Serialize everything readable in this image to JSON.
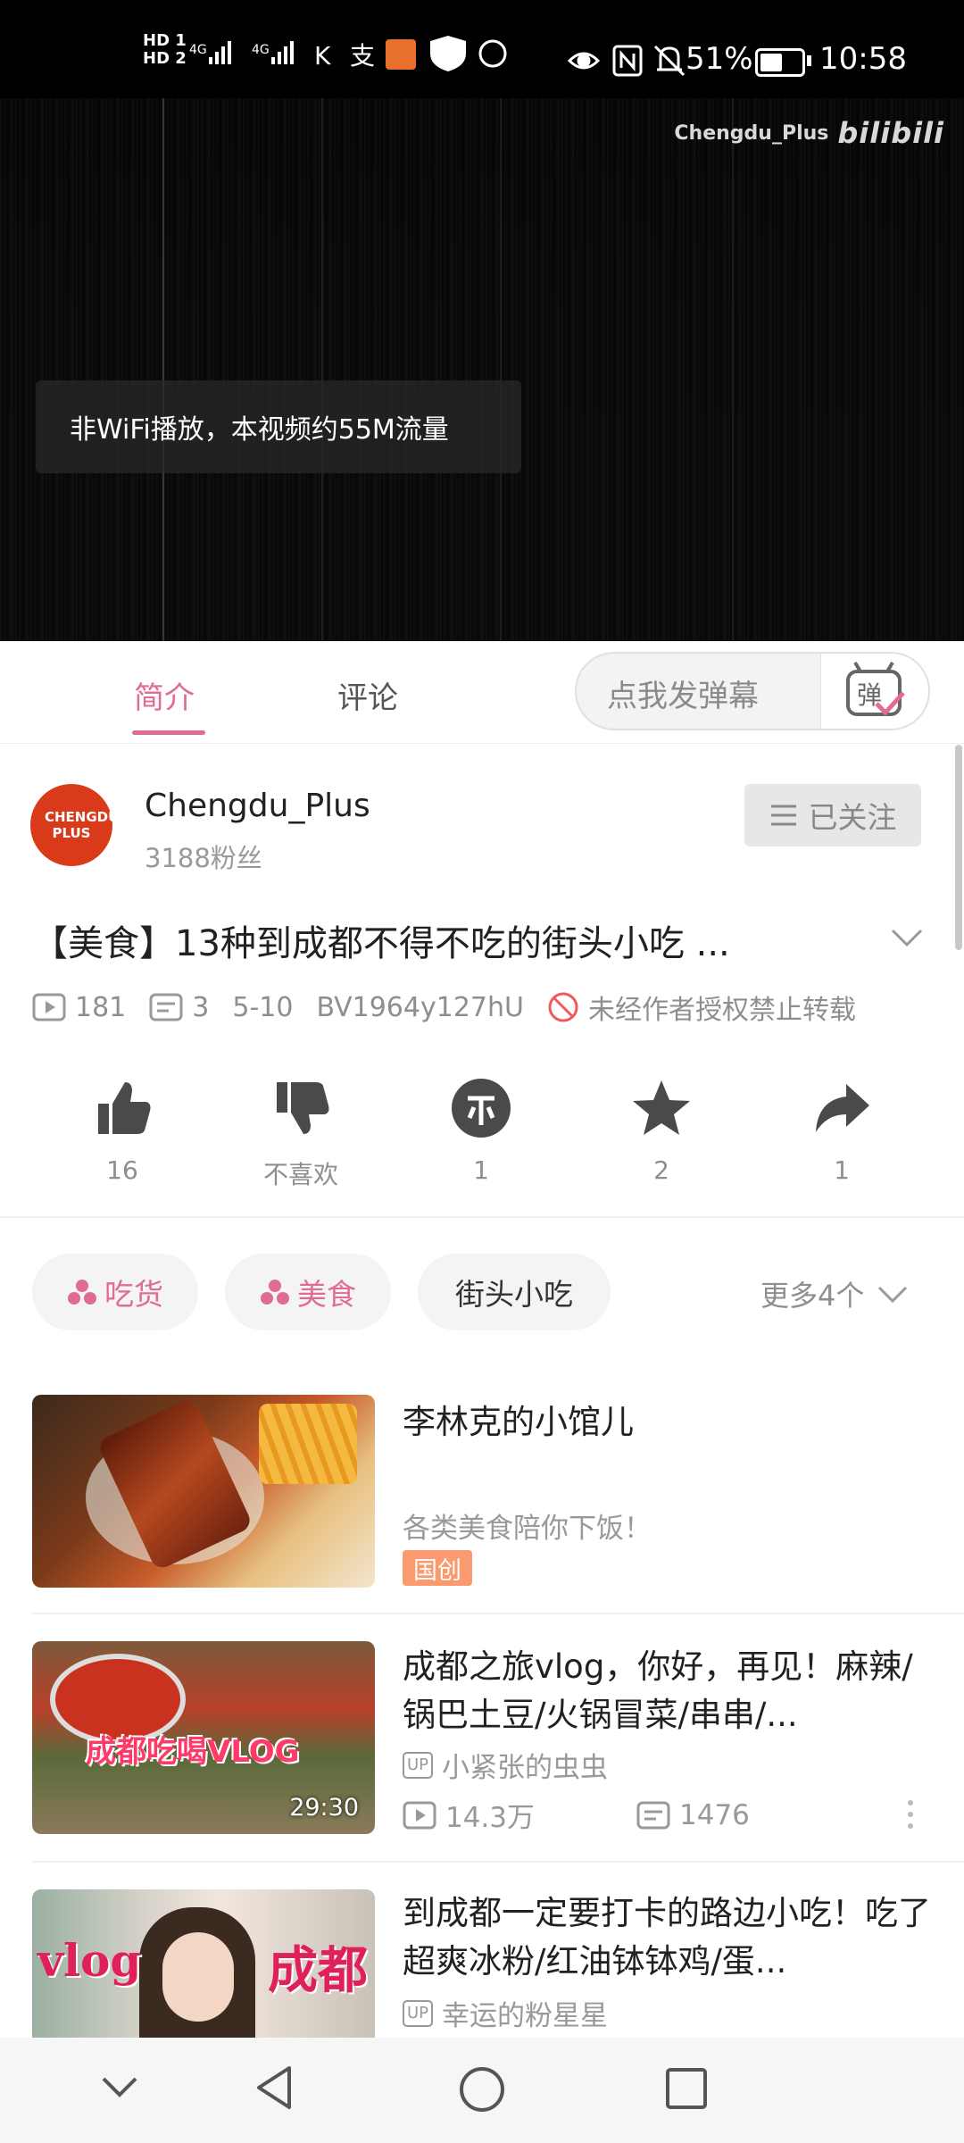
{
  "status_bar": {
    "battery": "51%",
    "time": "10:58"
  },
  "player": {
    "watermark_channel": "Chengdu_Plus",
    "watermark_logo": "bilibili",
    "toast": "非WiFi播放，本视频约55M流量"
  },
  "tabs": [
    {
      "label": "简介",
      "active": true
    },
    {
      "label": "评论",
      "active": false
    }
  ],
  "danmaku_input": {
    "placeholder": "点我发弹幕",
    "icon": "danmaku-toggle-icon"
  },
  "uploader": {
    "avatar_text": "CHENGDU PLUS",
    "name": "Chengdu_Plus",
    "fans": "3188粉丝",
    "follow_label": "已关注"
  },
  "video": {
    "title": "【美食】13种到成都不得不吃的街头小吃 ...",
    "views": "181",
    "danmaku_count": "3",
    "date": "5-10",
    "bvid": "BV1964y127hU",
    "copyright": "未经作者授权禁止转载"
  },
  "actions": [
    {
      "icon": "thumbs-up-icon",
      "label": "16"
    },
    {
      "icon": "thumbs-down-icon",
      "label": "不喜欢"
    },
    {
      "icon": "coin-icon",
      "label": "1"
    },
    {
      "icon": "star-icon",
      "label": "2"
    },
    {
      "icon": "share-icon",
      "label": "1"
    }
  ],
  "tags": [
    {
      "label": "吃货",
      "channel": true
    },
    {
      "label": "美食",
      "channel": true
    },
    {
      "label": "街头小吃",
      "channel": false
    }
  ],
  "more_tags": "更多4个",
  "related": [
    {
      "title": "李林克的小馆儿",
      "subtitle": "各类美食陪你下饭！",
      "badge": "国创"
    },
    {
      "title": "成都之旅vlog，你好，再见！麻辣/锅巴土豆/火锅冒菜/串串/...",
      "thumb_text": "成都吃喝VLOG",
      "duration": "29:30",
      "up": "小紧张的虫虫",
      "views": "14.3万",
      "danmaku": "1476"
    },
    {
      "title": "到成都一定要打卡的路边小吃！吃了超爽冰粉/红油钵钵鸡/蛋...",
      "thumb_text_left": "vlog",
      "thumb_text_right": "成都",
      "up": "幸运的粉星星"
    }
  ],
  "colors": {
    "accent_pink": "#e06c92",
    "badge_orange": "#fb9a6e"
  }
}
